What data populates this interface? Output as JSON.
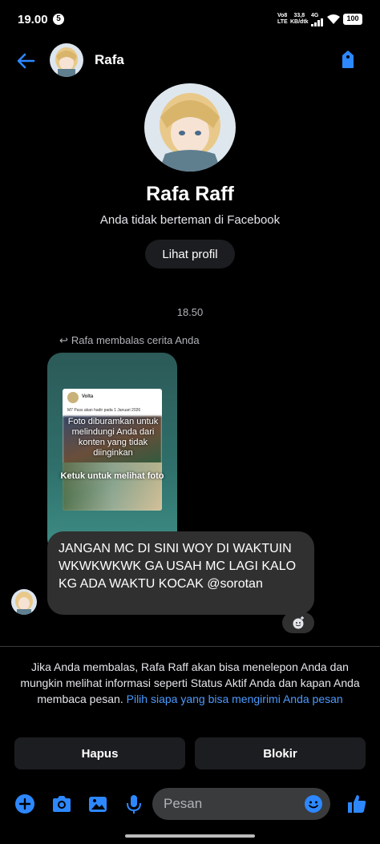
{
  "status_bar": {
    "time": "19.00",
    "notification_count": "5",
    "volte": "Vo8\nLTE",
    "speed": "33,8\nKB/dtk",
    "network": "4G",
    "battery": "100"
  },
  "header": {
    "name": "Rafa"
  },
  "profile": {
    "full_name": "Rafa Raff",
    "subtitle": "Anda tidak berteman di Facebook",
    "view_profile_label": "Lihat profil"
  },
  "conversation": {
    "timestamp": "18.50",
    "reply_note": "Rafa membalas cerita Anda",
    "story": {
      "poster_name": "Volta",
      "poster_text": "M7 Pass akan hadir pada 1 Januari 2026",
      "warning": "Foto diburamkan untuk melindungi Anda dari konten yang tidak diinginkan",
      "tap_label": "Ketuk untuk melihat foto"
    },
    "message": "JANGAN MC DI SINI WOY DI WAKTUIN WKWKWKWK GA USAH MC LAGI KALO KG ADA WAKTU KOCAK @sorotan"
  },
  "notice": {
    "text": "Jika Anda membalas, Rafa Raff akan bisa menelepon Anda dan mungkin melihat informasi seperti Status Aktif Anda dan kapan Anda membaca pesan.",
    "link": "Pilih siapa yang bisa mengirimi Anda pesan"
  },
  "actions": {
    "delete_label": "Hapus",
    "block_label": "Blokir"
  },
  "composer": {
    "placeholder": "Pesan"
  },
  "colors": {
    "accent": "#1877f2",
    "link": "#4c9bff",
    "bubble": "#303030"
  }
}
